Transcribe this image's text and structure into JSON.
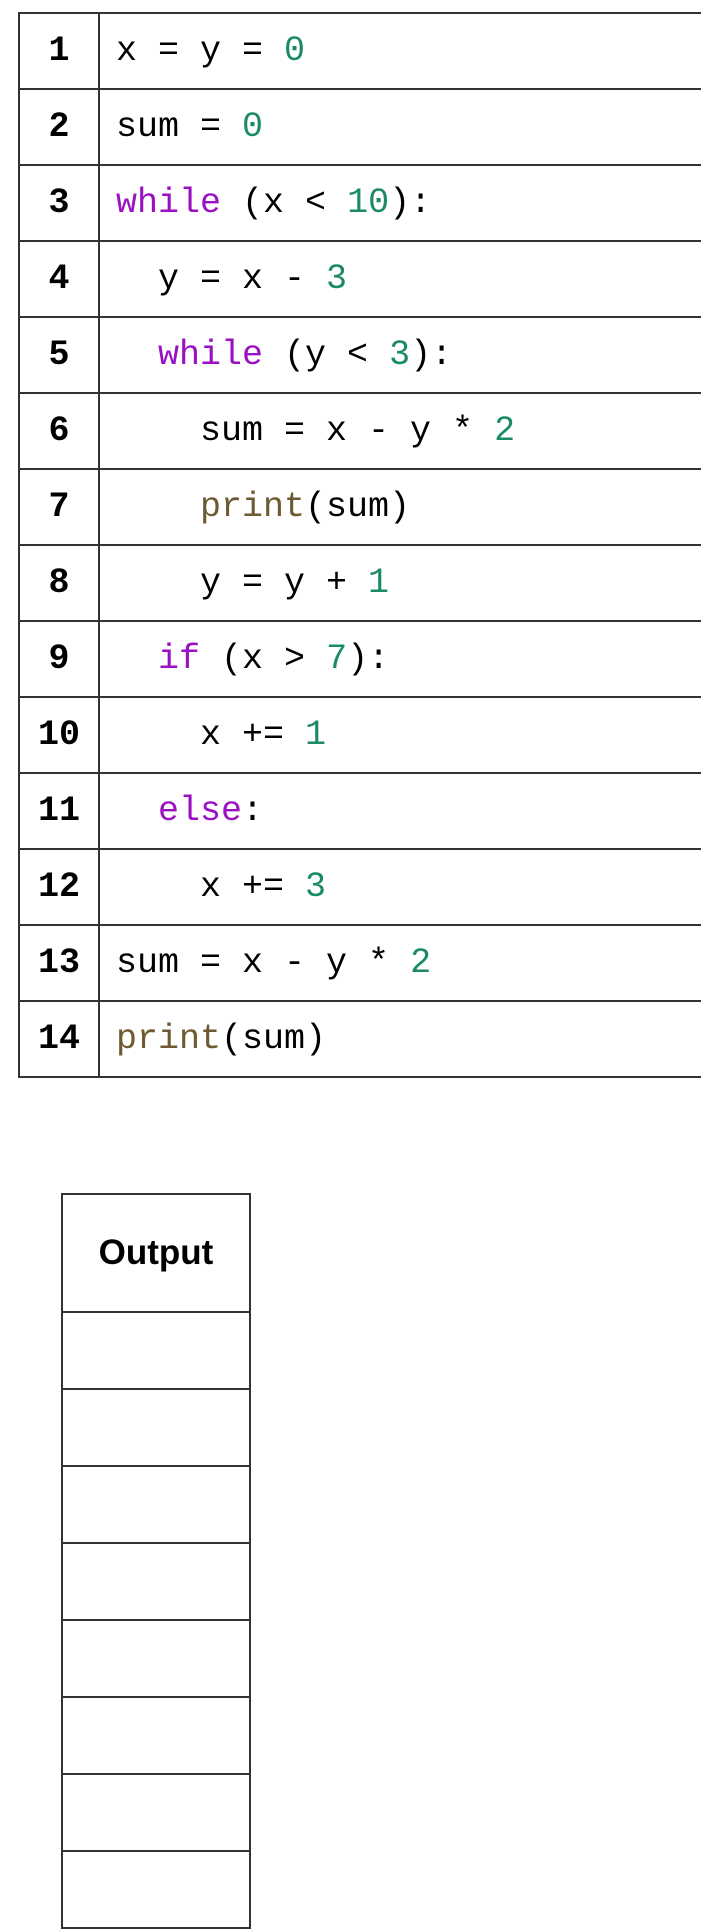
{
  "code_lines": [
    {
      "line": "1",
      "indent": "",
      "tokens": [
        {
          "t": "x = y = ",
          "c": ""
        },
        {
          "t": "0",
          "c": "num"
        }
      ]
    },
    {
      "line": "2",
      "indent": "",
      "tokens": [
        {
          "t": "sum = ",
          "c": ""
        },
        {
          "t": "0",
          "c": "num"
        }
      ]
    },
    {
      "line": "3",
      "indent": "",
      "tokens": [
        {
          "t": "while",
          "c": "kw"
        },
        {
          "t": " (x < ",
          "c": ""
        },
        {
          "t": "10",
          "c": "num"
        },
        {
          "t": "):",
          "c": ""
        }
      ]
    },
    {
      "line": "4",
      "indent": "  ",
      "tokens": [
        {
          "t": "y = x - ",
          "c": ""
        },
        {
          "t": "3",
          "c": "num"
        }
      ]
    },
    {
      "line": "5",
      "indent": "  ",
      "tokens": [
        {
          "t": "while",
          "c": "kw"
        },
        {
          "t": " (y < ",
          "c": ""
        },
        {
          "t": "3",
          "c": "num"
        },
        {
          "t": "):",
          "c": ""
        }
      ]
    },
    {
      "line": "6",
      "indent": "    ",
      "tokens": [
        {
          "t": "sum = x - y * ",
          "c": ""
        },
        {
          "t": "2",
          "c": "num"
        }
      ]
    },
    {
      "line": "7",
      "indent": "    ",
      "tokens": [
        {
          "t": "print",
          "c": "fn"
        },
        {
          "t": "(sum)",
          "c": ""
        }
      ]
    },
    {
      "line": "8",
      "indent": "    ",
      "tokens": [
        {
          "t": "y = y + ",
          "c": ""
        },
        {
          "t": "1",
          "c": "num"
        }
      ]
    },
    {
      "line": "9",
      "indent": "  ",
      "tokens": [
        {
          "t": "if",
          "c": "kw"
        },
        {
          "t": " (x > ",
          "c": ""
        },
        {
          "t": "7",
          "c": "num"
        },
        {
          "t": "):",
          "c": ""
        }
      ]
    },
    {
      "line": "10",
      "indent": "    ",
      "tokens": [
        {
          "t": "x += ",
          "c": ""
        },
        {
          "t": "1",
          "c": "num"
        }
      ]
    },
    {
      "line": "11",
      "indent": "  ",
      "tokens": [
        {
          "t": "else",
          "c": "kw"
        },
        {
          "t": ":",
          "c": ""
        }
      ]
    },
    {
      "line": "12",
      "indent": "    ",
      "tokens": [
        {
          "t": "x += ",
          "c": ""
        },
        {
          "t": "3",
          "c": "num"
        }
      ]
    },
    {
      "line": "13",
      "indent": "",
      "tokens": [
        {
          "t": "sum = x - y * ",
          "c": ""
        },
        {
          "t": "2",
          "c": "num"
        }
      ]
    },
    {
      "line": "14",
      "indent": "",
      "tokens": [
        {
          "t": "print",
          "c": "fn"
        },
        {
          "t": "(sum)",
          "c": ""
        }
      ]
    }
  ],
  "output_table": {
    "header": "Output",
    "rows": [
      "",
      "",
      "",
      "",
      "",
      "",
      "",
      ""
    ]
  },
  "colors": {
    "keyword": "#9a10c2",
    "number": "#1b8a66",
    "function": "#6e5a30"
  }
}
